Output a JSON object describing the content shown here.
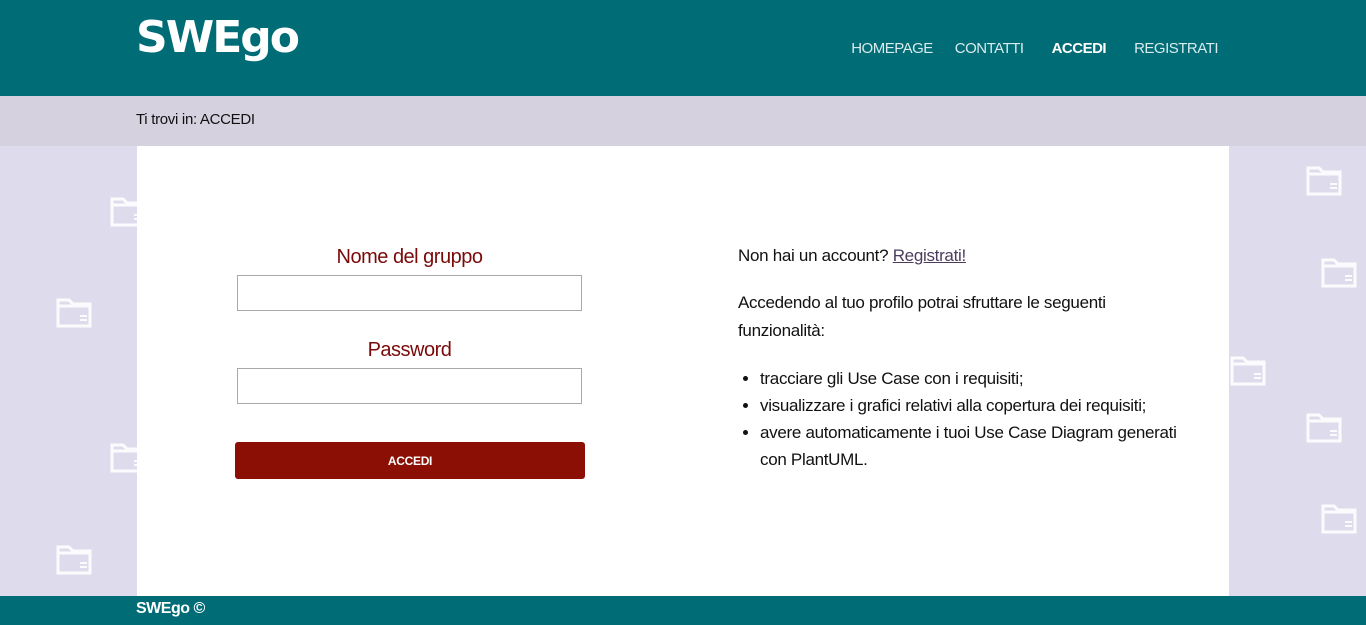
{
  "header": {
    "logo_text": "SWEgo",
    "nav": [
      {
        "label": "HOMEPAGE",
        "active": false
      },
      {
        "label": "CONTATTI",
        "active": false
      },
      {
        "label": "ACCEDI",
        "active": true
      },
      {
        "label": "REGISTRATI",
        "active": false
      }
    ]
  },
  "breadcrumb": {
    "text": "Ti trovi in: ACCEDI"
  },
  "login_form": {
    "group_label": "Nome del gruppo",
    "group_value": "",
    "password_label": "Password",
    "password_value": "",
    "submit_label": "ACCEDI"
  },
  "info": {
    "no_account_text": "Non hai un account?",
    "register_link": "Registrati!",
    "intro": "Accedendo al tuo profilo potrai sfruttare le seguenti funzionalità:",
    "features": [
      "tracciare gli Use Case con i requisiti;",
      "visualizzare i grafici relativi alla copertura dei requisiti;",
      "avere automaticamente i tuoi Use Case Diagram generati con PlantUML."
    ]
  },
  "footer": {
    "text": "SWEgo ©"
  },
  "colors": {
    "header_bg": "#006c75",
    "breadcrumb_bg": "#d5d1df",
    "page_bg": "#dedcec",
    "label_color": "#7a0a0a",
    "button_bg": "#8b0f04"
  },
  "background_icons": "folder-icon"
}
